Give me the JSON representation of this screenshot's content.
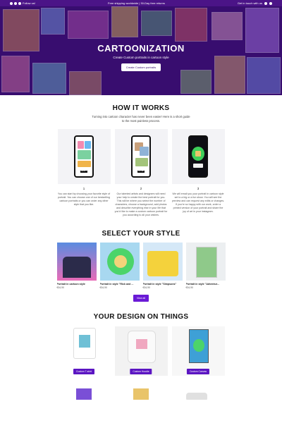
{
  "topbar": {
    "follow": "Follow us!",
    "shipping": "Free shipping worldwide | 30-Day free returns",
    "contact": "Get in touch with us"
  },
  "hero": {
    "title": "CARTOONIZATION",
    "subtitle": "Create Custom portraits in cartoon style",
    "cta": "Create Custom portraits"
  },
  "how": {
    "title": "HOW IT WORKS",
    "intro_1": "Turning into cartoon character has never been easier! Here is a short guide",
    "intro_2": "to the most painless process.",
    "steps": [
      {
        "num": "1",
        "button": "SELECT",
        "desc": "You can start by choosing your favorite style of portrait. You can choose one of our bestselling cartoon portraits or you can order any other style that you like."
      },
      {
        "num": "2",
        "button": "UPLOAD",
        "desc": "Our talented artists and designers will need your help to create the best portrait for you. This will be where you select the number of characters, choose a background, add photos and describe everything else in your life that you’d like to make a custom cartoon portrait for you according to all your wishes."
      },
      {
        "num": "3",
        "button": "",
        "desc": "We will email you your portrait in cartoon style set to a big or a fun show. You will see the preview and can request any edits or changes. If you’re so happy with our work, order a printed version of your portrait and share the joy of art in your instagram."
      }
    ]
  },
  "styles": {
    "title": "SELECT YOUR STYLE",
    "items": [
      {
        "name": "Portrait in cartoon style",
        "price": "€34,90"
      },
      {
        "name": "Portrait in style \"Rick and ...",
        "price": "€34,90"
      },
      {
        "name": "Portrait in style \"Simpsons\"",
        "price": "€34,90"
      },
      {
        "name": "Portrait in style \"Adventur...",
        "price": "€34,90"
      }
    ],
    "view_all": "View all"
  },
  "things": {
    "title": "YOUR DESIGN ON THINGS",
    "items": [
      {
        "label": "Custom T-shirt"
      },
      {
        "label": "Custom Hoodie"
      },
      {
        "label": "Custom Canvas"
      }
    ]
  },
  "colors": {
    "brand": "#4b1487",
    "accent": "#6a1ad6",
    "button": "#5b15c2"
  }
}
